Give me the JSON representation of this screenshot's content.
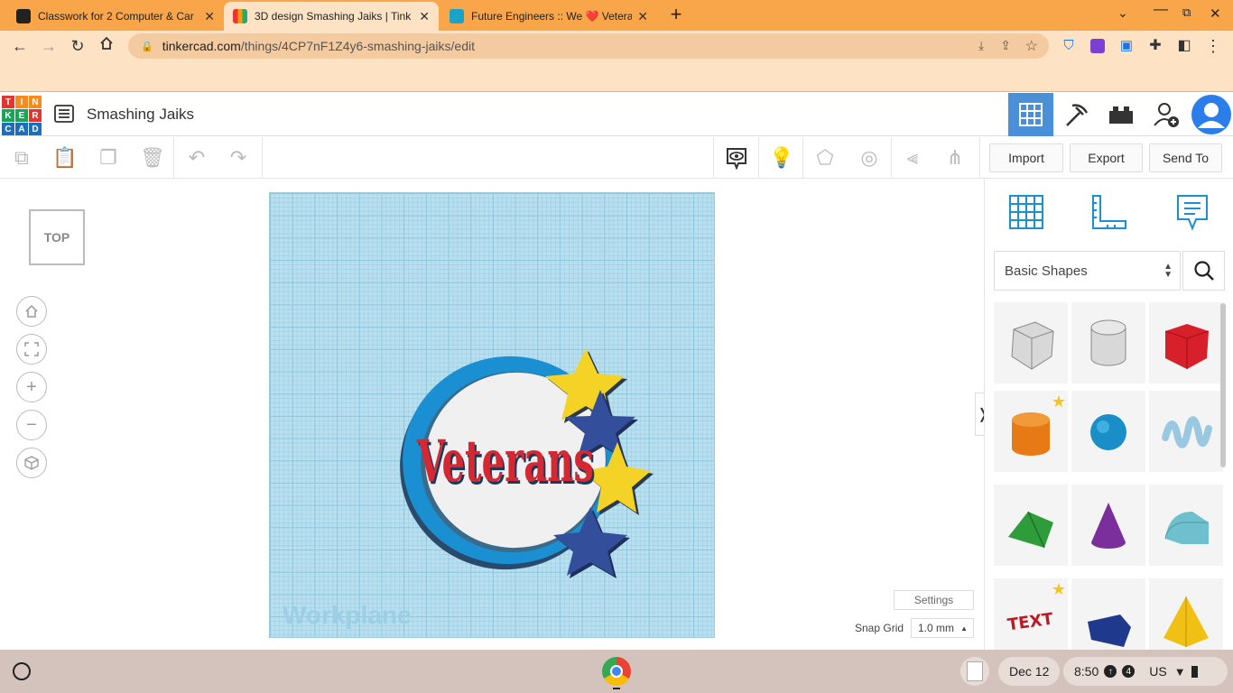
{
  "browser": {
    "tabs": [
      {
        "title": "Classwork for 2 Computer & Car",
        "active": false
      },
      {
        "title": "3D design Smashing Jaiks | Tink",
        "active": true
      },
      {
        "title": "Future Engineers :: We ❤️ Vetera",
        "active": false
      }
    ],
    "url_host": "tinkercad.com",
    "url_path": "/things/4CP7nF1Z4y6-smashing-jaiks/edit"
  },
  "app": {
    "logo_letters": [
      "T",
      "I",
      "N",
      "K",
      "E",
      "R",
      "C",
      "A",
      "D"
    ],
    "design_title": "Smashing Jaiks"
  },
  "toolbar": {
    "import_label": "Import",
    "export_label": "Export",
    "send_to_label": "Send To"
  },
  "workspace": {
    "view_cube_label": "TOP",
    "workplane_label": "Workplane",
    "design_text": "Veterans",
    "settings_label": "Settings",
    "snap_grid_label": "Snap Grid",
    "snap_grid_value": "1.0 mm"
  },
  "shapes_panel": {
    "category": "Basic Shapes",
    "shapes": [
      "box",
      "cylinder-hole",
      "box",
      "cylinder",
      "sphere",
      "scribble",
      "roof",
      "cone",
      "round-roof",
      "text",
      "wedge",
      "pyramid"
    ]
  },
  "taskbar": {
    "date": "Dec 12",
    "time": "8:50",
    "notification_count": "4",
    "locale": "US"
  },
  "colors": {
    "tab_strip": "#f9a64a",
    "toolbar_bg": "#fde3c4",
    "workplane": "#b9e0f0",
    "accent_blue": "#1a8fd2",
    "text_red": "#d62832",
    "star_yellow": "#f5d326",
    "star_blue": "#334f9c"
  }
}
